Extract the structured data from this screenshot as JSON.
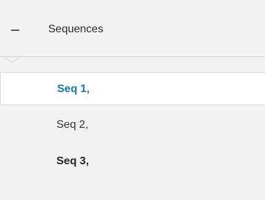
{
  "tree": {
    "group": {
      "label": "Sequences",
      "expanded": true,
      "icon": "minus-icon"
    },
    "items": [
      {
        "label": "Seq 1,",
        "selected": true,
        "bold": true,
        "color": "#1a75b8"
      },
      {
        "label": "Seq 2,",
        "selected": false,
        "bold": false,
        "color": "#333333"
      },
      {
        "label": "Seq 3,",
        "selected": false,
        "bold": true,
        "color": "#262626"
      }
    ]
  },
  "colors": {
    "background": "#f2f2f2",
    "selected_background": "#ffffff",
    "accent": "#1a75b8",
    "divider": "#d4d4d4"
  }
}
